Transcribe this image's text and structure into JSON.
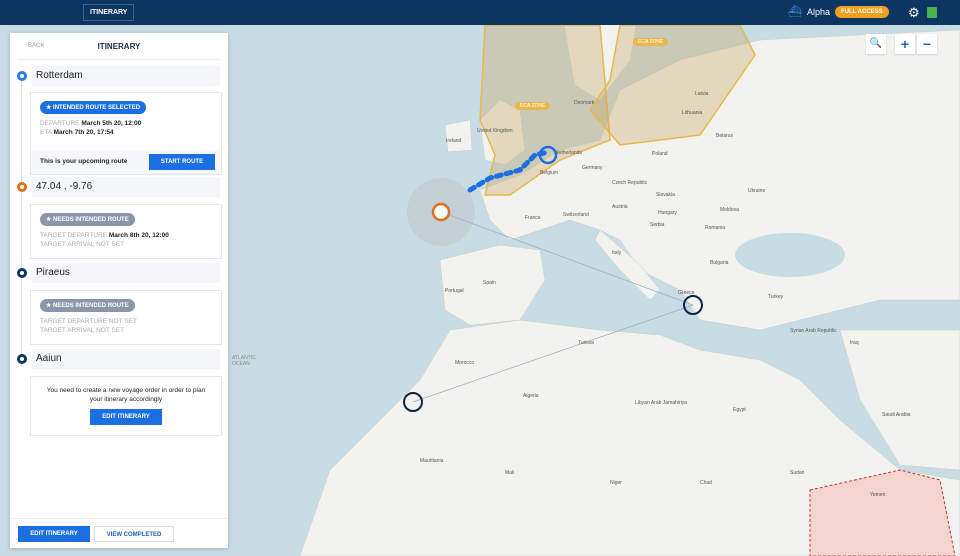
{
  "header": {
    "tab": "ITINERARY",
    "user": "Alpha",
    "access_badge": "FULL ACCESS",
    "icons": [
      "ship-icon",
      "gear-icon",
      "status-icon"
    ]
  },
  "map_controls": {
    "search": "🔍",
    "zoom_in": "+",
    "zoom_out": "−"
  },
  "panel": {
    "back": "BACK",
    "title": "ITINERARY",
    "stops": [
      {
        "name": "Rotterdam",
        "color": "#2a7de1",
        "badge": "★ INTENDED ROUTE SELECTED",
        "badge_color": "#1b6fe0",
        "l1_label": "DEPARTURE",
        "l1_value": "March 5th 20, 12:00",
        "l2_label": "ETA",
        "l2_value": "March 7th 20, 17:54",
        "footer_text": "This is your upcoming route",
        "footer_button": "START ROUTE"
      },
      {
        "name": "47.04 , -9.76",
        "color": "#e07020",
        "badge": "★ NEEDS INTENDED ROUTE",
        "badge_color": "#8a97a8",
        "l1_label": "TARGET DEPARTURE",
        "l1_value": "March 8th 20, 12:00",
        "l2_label": "TARGET ARRIVAL NOT SET",
        "l2_value": ""
      },
      {
        "name": "Piraeus",
        "color": "#0d3562",
        "badge": "★ NEEDS INTENDED ROUTE",
        "badge_color": "#8a97a8",
        "l1_label": "TARGET DEPARTURE NOT SET",
        "l1_value": "",
        "l2_label": "TARGET ARRIVAL NOT SET",
        "l2_value": ""
      },
      {
        "name": "Aaiun",
        "color": "#0d3562",
        "message": "You need to create a new voyage order in order to plan your itinerary accordingly",
        "button": "EDIT ITINERARY"
      }
    ],
    "footer": {
      "edit": "EDIT ITINERARY",
      "view_completed": "VIEW COMPLETED"
    }
  },
  "map": {
    "zones": [
      "ECA ZONE",
      "ECA ZONE"
    ],
    "labels": [
      "Ireland",
      "United Kingdom",
      "Denmark",
      "Netherlands",
      "Belgium",
      "Germany",
      "Poland",
      "Latvia",
      "Lithuania",
      "Belarus",
      "Ukraine",
      "Czech Republic",
      "Austria",
      "Hungary",
      "Slovakia",
      "Switzerland",
      "France",
      "Romania",
      "Moldova",
      "Spain",
      "Portugal",
      "Italy",
      "Greece",
      "Turkey",
      "Bulgaria",
      "Serbia",
      "Syrian Arab Republic",
      "Iraq",
      "Morocco",
      "Algeria",
      "Tunisia",
      "Libyan Arab Jamahiriya",
      "Egypt",
      "Saudi Arabia",
      "Mauritania",
      "Mali",
      "Niger",
      "Chad",
      "Sudan",
      "Yemen",
      "ATLANTIC OCEAN"
    ],
    "colors": {
      "sea": "#c8dce4",
      "land": "#f2f2ef",
      "eca": "#e8b84a",
      "route": "#1b6fe0"
    }
  }
}
